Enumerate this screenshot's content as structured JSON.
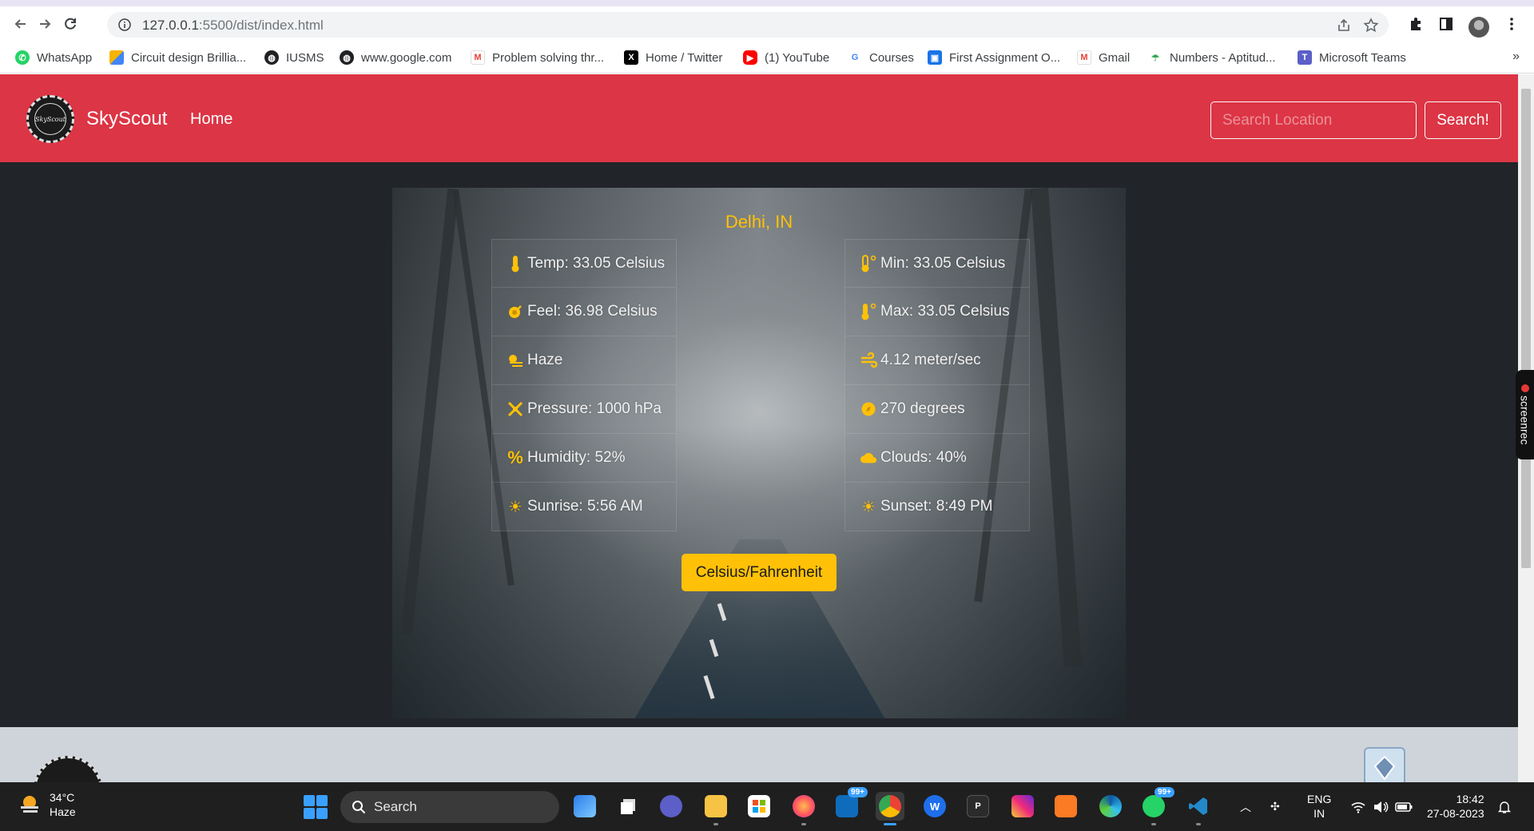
{
  "browser": {
    "url_host": "127.0.0.1",
    "url_path": ":5500/dist/index.html",
    "bookmarks": [
      {
        "label": "WhatsApp",
        "icon": "whatsapp-icon",
        "color": "#25d366"
      },
      {
        "label": "Circuit design Brillia...",
        "icon": "grid-icon",
        "color": "#f4b400"
      },
      {
        "label": "IUSMS",
        "icon": "globe-icon",
        "color": "#202124"
      },
      {
        "label": "www.google.com",
        "icon": "globe-icon",
        "color": "#202124"
      },
      {
        "label": "Problem solving thr...",
        "icon": "gmail-icon",
        "color": "#ea4335"
      },
      {
        "label": "Home / Twitter",
        "icon": "x-icon",
        "color": "#000000"
      },
      {
        "label": "(1) YouTube",
        "icon": "youtube-icon",
        "color": "#ff0000"
      },
      {
        "label": "Courses",
        "icon": "google-icon",
        "color": "#4285f4"
      },
      {
        "label": "First Assignment O...",
        "icon": "classroom-icon",
        "color": "#1a73e8"
      },
      {
        "label": "Gmail",
        "icon": "gmail-icon",
        "color": "#ea4335"
      },
      {
        "label": "Numbers - Aptitud...",
        "icon": "umbrella-icon",
        "color": "#34a853"
      },
      {
        "label": "Microsoft Teams",
        "icon": "teams-icon",
        "color": "#5b5fc7"
      }
    ],
    "more": "»"
  },
  "navbar": {
    "brand": "SkyScout",
    "logo_text": "SkyScout",
    "home": "Home",
    "search_placeholder": "Search Location",
    "search_button": "Search!"
  },
  "weather": {
    "city": "Delhi, IN",
    "left": [
      {
        "icon": "thermometer-icon",
        "text": "Temp: 33.05 Celsius"
      },
      {
        "icon": "feel-icon",
        "text": "Feel: 36.98 Celsius"
      },
      {
        "icon": "haze-icon",
        "text": "Haze"
      },
      {
        "icon": "pressure-icon",
        "text": "Pressure: 1000 hPa"
      },
      {
        "icon": "percent-icon",
        "text": "Humidity: 52%"
      },
      {
        "icon": "sun-icon",
        "text": "Sunrise: 5:56 AM"
      }
    ],
    "right": [
      {
        "icon": "temp-low-icon",
        "text": "Min: 33.05 Celsius"
      },
      {
        "icon": "temp-high-icon",
        "text": "Max: 33.05 Celsius"
      },
      {
        "icon": "wind-icon",
        "text": "4.12 meter/sec"
      },
      {
        "icon": "compass-icon",
        "text": "270 degrees"
      },
      {
        "icon": "cloud-icon",
        "text": "Clouds: 40%"
      },
      {
        "icon": "sun-icon",
        "text": "Sunset: 8:49 PM"
      }
    ],
    "toggle_button": "Celsius/Fahrenheit",
    "accent": "#ffc107"
  },
  "screenrec": "screenrec",
  "taskbar": {
    "weather_temp": "34°C",
    "weather_desc": "Haze",
    "search": "Search",
    "badge_mail": "99+",
    "badge_whatsapp": "99+",
    "app_p": "P",
    "lang_top": "ENG",
    "lang_bottom": "IN",
    "time": "18:42",
    "date": "27-08-2023"
  }
}
